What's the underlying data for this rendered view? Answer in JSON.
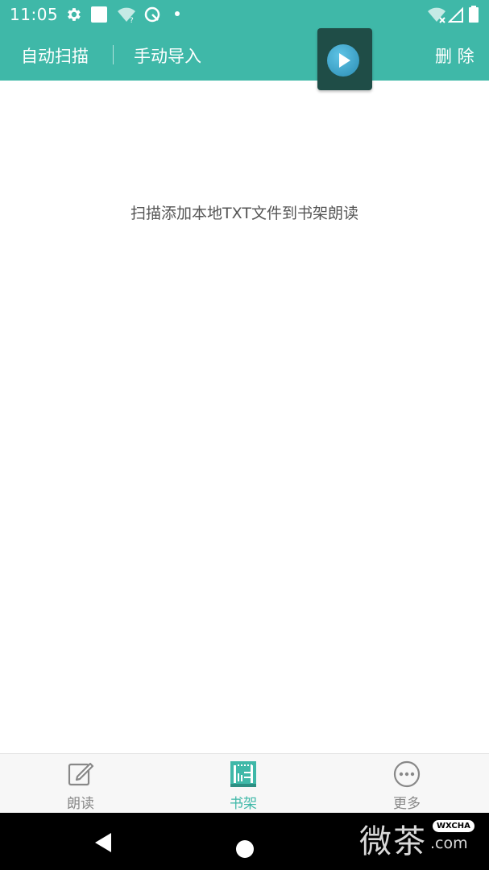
{
  "status_bar": {
    "time": "11:05"
  },
  "app_bar": {
    "auto_scan_label": "自动扫描",
    "manual_import_label": "手动导入",
    "delete_label": "删 除"
  },
  "main": {
    "empty_hint": "扫描添加本地TXT文件到书架朗读"
  },
  "bottom_nav": {
    "items": [
      {
        "label": "朗读",
        "icon": "edit-icon",
        "active": false
      },
      {
        "label": "书架",
        "icon": "bookshelf-icon",
        "active": true
      },
      {
        "label": "更多",
        "icon": "more-icon",
        "active": false
      }
    ]
  },
  "watermark": {
    "text_cn": "微茶",
    "badge": "WXCHA",
    "domain": ".com"
  },
  "colors": {
    "accent": "#3fb8a8",
    "inactive": "#888888"
  }
}
